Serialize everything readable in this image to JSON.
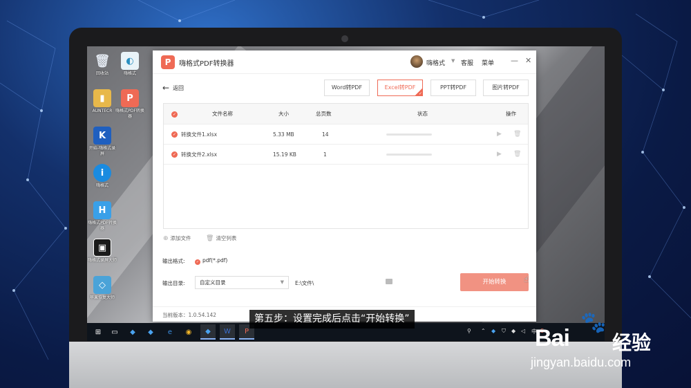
{
  "app": {
    "title": "嗨格式PDF转换器",
    "logo_letter": "P",
    "username": "嗨格式",
    "support_label": "客服",
    "menu_label": "菜单",
    "minimize_glyph": "—",
    "close_glyph": "✕",
    "back_label": "返回",
    "tabs": [
      {
        "label": "Word转PDF",
        "active": false
      },
      {
        "label": "Excel转PDF",
        "active": true
      },
      {
        "label": "PPT转PDF",
        "active": false
      },
      {
        "label": "图片转PDF",
        "active": false
      }
    ],
    "table": {
      "headers": {
        "name": "文件名称",
        "size": "大小",
        "pages": "总页数",
        "status": "状态",
        "actions": "操作"
      },
      "rows": [
        {
          "name": "转换文件1.xlsx",
          "size": "5.33 MB",
          "pages": "14",
          "progress": 0
        },
        {
          "name": "转换文件2.xlsx",
          "size": "15.19 KB",
          "pages": "1",
          "progress": 0
        }
      ]
    },
    "add_file_label": "添加文件",
    "clear_list_label": "清空列表",
    "output_format_label": "输出格式:",
    "output_format_value": "pdf(*.pdf)",
    "output_dir_label": "输出目录:",
    "output_dir_select": "自定义目录",
    "output_dir_path": "E:\\文件\\",
    "start_button_label": "开始转换",
    "version": "当前版本：1.0.54.142",
    "accent_color": "#ef6a55"
  },
  "desktop_icons": [
    {
      "label": "回收站",
      "icon": "recycle-bin-icon"
    },
    {
      "label": "嗨格式",
      "icon": "app-shortcut-icon"
    },
    {
      "label": "AUNTECR",
      "icon": "folder-icon"
    },
    {
      "label": "嗨格式PDF转换器",
      "icon": "pdf-converter-icon"
    },
    {
      "label": "开始-嗨格式录屏",
      "icon": "k-app-icon"
    },
    {
      "label": "嗨格式",
      "icon": "info-app-icon"
    },
    {
      "label": "嗨格式PDF转换器",
      "icon": "h-app-icon"
    },
    {
      "label": "嗨格式录屏大师",
      "icon": "recorder-icon"
    },
    {
      "label": "苹果恢复大师",
      "icon": "recovery-icon"
    }
  ],
  "subtitle": "第五步：设置完成后点击“开始转换”",
  "taskbar": {
    "items": [
      "windows-start-icon",
      "task-view-icon",
      "app-icon",
      "app-icon",
      "edge-icon",
      "chrome-icon",
      "app-icon",
      "word-icon",
      "pdf-converter-icon"
    ],
    "tray_text": "中"
  },
  "watermark": {
    "brand": "Bai",
    "brand_suffix": "经验",
    "url": "jingyan.baidu.com"
  }
}
